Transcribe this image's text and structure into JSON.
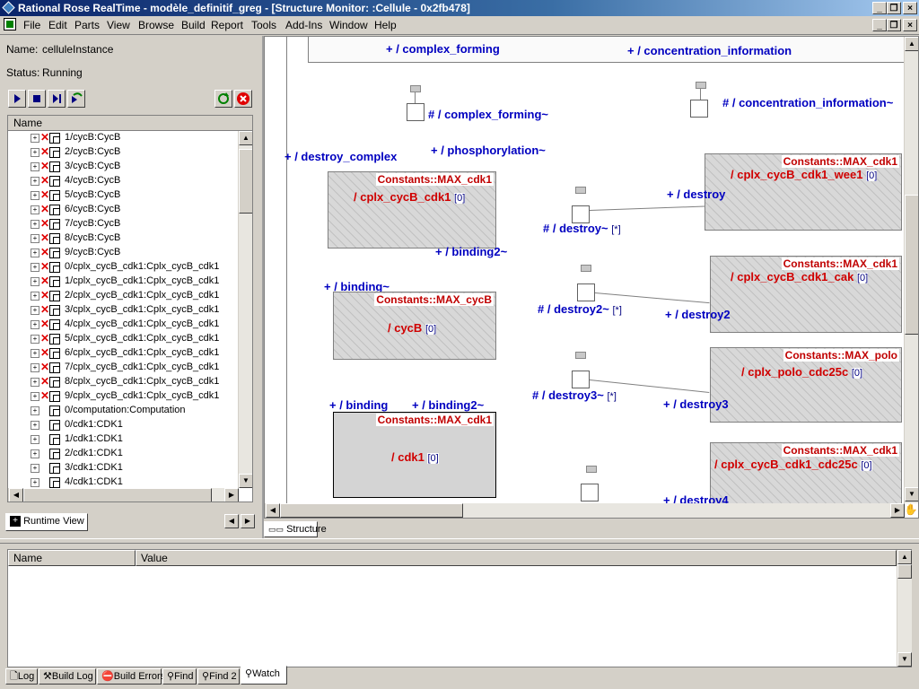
{
  "window": {
    "title": "Rational Rose RealTime - modèle_definitif_greg - [Structure Monitor: :Cellule - 0x2fb478]"
  },
  "menu": [
    "File",
    "Edit",
    "Parts",
    "View",
    "Browse",
    "Build",
    "Report",
    "Tools",
    "Add-Ins",
    "Window",
    "Help"
  ],
  "instance": {
    "name_label": "Name:",
    "name_value": "celluleInstance",
    "status_label": "Status:",
    "status_value": "Running"
  },
  "tree": {
    "header": "Name",
    "items": [
      {
        "label": "1/cycB:CycB",
        "error": true
      },
      {
        "label": "2/cycB:CycB",
        "error": true
      },
      {
        "label": "3/cycB:CycB",
        "error": true
      },
      {
        "label": "4/cycB:CycB",
        "error": true
      },
      {
        "label": "5/cycB:CycB",
        "error": true
      },
      {
        "label": "6/cycB:CycB",
        "error": true
      },
      {
        "label": "7/cycB:CycB",
        "error": true
      },
      {
        "label": "8/cycB:CycB",
        "error": true
      },
      {
        "label": "9/cycB:CycB",
        "error": true
      },
      {
        "label": "0/cplx_cycB_cdk1:Cplx_cycB_cdk1",
        "error": true
      },
      {
        "label": "1/cplx_cycB_cdk1:Cplx_cycB_cdk1",
        "error": true
      },
      {
        "label": "2/cplx_cycB_cdk1:Cplx_cycB_cdk1",
        "error": true
      },
      {
        "label": "3/cplx_cycB_cdk1:Cplx_cycB_cdk1",
        "error": true
      },
      {
        "label": "4/cplx_cycB_cdk1:Cplx_cycB_cdk1",
        "error": true
      },
      {
        "label": "5/cplx_cycB_cdk1:Cplx_cycB_cdk1",
        "error": true
      },
      {
        "label": "6/cplx_cycB_cdk1:Cplx_cycB_cdk1",
        "error": true
      },
      {
        "label": "7/cplx_cycB_cdk1:Cplx_cycB_cdk1",
        "error": true
      },
      {
        "label": "8/cplx_cycB_cdk1:Cplx_cycB_cdk1",
        "error": true
      },
      {
        "label": "9/cplx_cycB_cdk1:Cplx_cycB_cdk1",
        "error": true
      },
      {
        "label": "0/computation:Computation",
        "error": false
      },
      {
        "label": "0/cdk1:CDK1",
        "error": false
      },
      {
        "label": "1/cdk1:CDK1",
        "error": false
      },
      {
        "label": "2/cdk1:CDK1",
        "error": false
      },
      {
        "label": "3/cdk1:CDK1",
        "error": false
      },
      {
        "label": "4/cdk1:CDK1",
        "error": false
      }
    ]
  },
  "left_tab": "Runtime View",
  "diagram_tab": "Structure",
  "diagram": {
    "ports": {
      "complex_forming": "+ / complex_forming",
      "concentration_information": "+ / concentration_information",
      "complex_forming_conj": "# / complex_forming~",
      "concentration_information_conj": "# / concentration_information~",
      "destroy_complex": "+ / destroy_complex",
      "phosphorylation": "+ / phosphorylation~",
      "destroy": "+ / destroy",
      "destroy_conj": "# / destroy~",
      "binding2_conj_a": "+ / binding2~",
      "binding_conj": "+ / binding~",
      "destroy2_conj": "# / destroy2~",
      "destroy2": "+ / destroy2",
      "destroy3_conj": "# / destroy3~",
      "destroy3": "+ / destroy3",
      "binding": "+ / binding",
      "binding2_conj_b": "+ / binding2~",
      "destroy4": "+ / destroy4",
      "star": "[*]"
    },
    "capsules": {
      "c1": {
        "const": "Constants::MAX_cdk1",
        "name": "/ cplx_cycB_cdk1",
        "mult": "[0]"
      },
      "c2": {
        "const": "Constants::MAX_cycB",
        "name": "/ cycB",
        "mult": "[0]"
      },
      "c3": {
        "const": "Constants::MAX_cdk1",
        "name": "/ cdk1",
        "mult": "[0]"
      },
      "c4": {
        "const": "Constants::MAX_cdk1",
        "name": "/ cplx_cycB_cdk1_wee1",
        "mult": "[0]"
      },
      "c5": {
        "const": "Constants::MAX_cdk1",
        "name": "/ cplx_cycB_cdk1_cak",
        "mult": "[0]"
      },
      "c6": {
        "const": "Constants::MAX_polo",
        "name": "/ cplx_polo_cdc25c",
        "mult": "[0]"
      },
      "c7": {
        "const": "Constants::MAX_cdk1",
        "name": "/ cplx_cycB_cdk1_cdc25c",
        "mult": "[0]"
      }
    }
  },
  "watch": {
    "columns": [
      "Name",
      "Value"
    ]
  },
  "bottom_tabs": [
    "Log",
    "Build Log",
    "Build Errors",
    "Find",
    "Find 2",
    "Watch"
  ],
  "colors": {
    "port": "#0000c0",
    "capsule_name": "#d00000",
    "error": "#e00000",
    "title_start": "#0a246a"
  }
}
